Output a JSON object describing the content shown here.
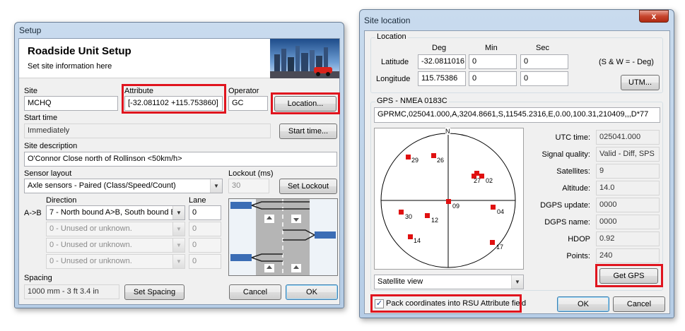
{
  "setup": {
    "window_title": "Setup",
    "header_title": "Roadside Unit Setup",
    "header_subtitle": "Set site information here",
    "site_label": "Site",
    "site_value": "MCHQ",
    "attribute_label": "Attribute",
    "attribute_value": "[-32.081102 +115.753860]",
    "operator_label": "Operator",
    "operator_value": "GC",
    "location_button": "Location...",
    "start_time_label": "Start time",
    "start_time_value": "Immediately",
    "start_time_button": "Start time...",
    "site_description_label": "Site description",
    "site_description_value": "O'Connor Close north of Rollinson <50km/h>",
    "sensor_layout_label": "Sensor layout",
    "sensor_layout_value": "Axle sensors - Paired (Class/Speed/Count)",
    "lockout_label": "Lockout (ms)",
    "lockout_value": "30",
    "set_lockout_button": "Set Lockout",
    "direction_label": "Direction",
    "lane_label": "Lane",
    "ab_label": "A->B",
    "direction_rows": [
      {
        "direction": "7 - North bound A>B, South bound B",
        "lane": "0",
        "enabled": true
      },
      {
        "direction": "0 - Unused or unknown.",
        "lane": "0",
        "enabled": false
      },
      {
        "direction": "0 - Unused or unknown.",
        "lane": "0",
        "enabled": false
      },
      {
        "direction": "0 - Unused or unknown.",
        "lane": "0",
        "enabled": false
      }
    ],
    "spacing_label": "Spacing",
    "spacing_value": "1000 mm - 3 ft 3.4 in",
    "set_spacing_button": "Set Spacing",
    "cancel_button": "Cancel",
    "ok_button": "OK"
  },
  "site_location": {
    "window_title": "Site location",
    "close_glyph": "x",
    "location_group": "Location",
    "col_deg": "Deg",
    "col_min": "Min",
    "col_sec": "Sec",
    "latitude_label": "Latitude",
    "latitude_deg": "-32.0811016",
    "latitude_min": "0",
    "latitude_sec": "0",
    "longitude_label": "Longitude",
    "longitude_deg": "115.75386",
    "longitude_min": "0",
    "longitude_sec": "0",
    "sign_note": "(S & W = - Deg)",
    "utm_button": "UTM...",
    "gps_group": "GPS - NMEA 0183C",
    "nmea_sentence": "GPRMC,025041.000,A,3204.8661,S,11545.2316,E,0.00,100.31,210409,,,D*77",
    "compass_north": "N",
    "satellites": [
      {
        "id": "29"
      },
      {
        "id": "26"
      },
      {
        "id": "27"
      },
      {
        "id": "02"
      },
      {
        "id": "09"
      },
      {
        "id": "04"
      },
      {
        "id": "30"
      },
      {
        "id": "12"
      },
      {
        "id": "14"
      },
      {
        "id": "17"
      }
    ],
    "view_select": "Satellite view",
    "fields": [
      {
        "label": "UTC time:",
        "value": "025041.000"
      },
      {
        "label": "Signal quality:",
        "value": "Valid - Diff, SPS"
      },
      {
        "label": "Satellites:",
        "value": "9"
      },
      {
        "label": "Altitude:",
        "value": "14.0"
      },
      {
        "label": "DGPS update:",
        "value": "0000"
      },
      {
        "label": "DGPS name:",
        "value": "0000"
      },
      {
        "label": "HDOP",
        "value": "0.92"
      },
      {
        "label": "Points:",
        "value": "240"
      }
    ],
    "get_gps_button": "Get GPS",
    "pack_checkbox_label": "Pack coordinates into RSU Attribute field",
    "pack_checked": true,
    "ok_button": "OK",
    "cancel_button": "Cancel"
  },
  "colors": {
    "highlight": "#e0141e",
    "satellite": "#e01010",
    "road": "#b5b5b5",
    "arrow_bg": "#3b6db5"
  }
}
